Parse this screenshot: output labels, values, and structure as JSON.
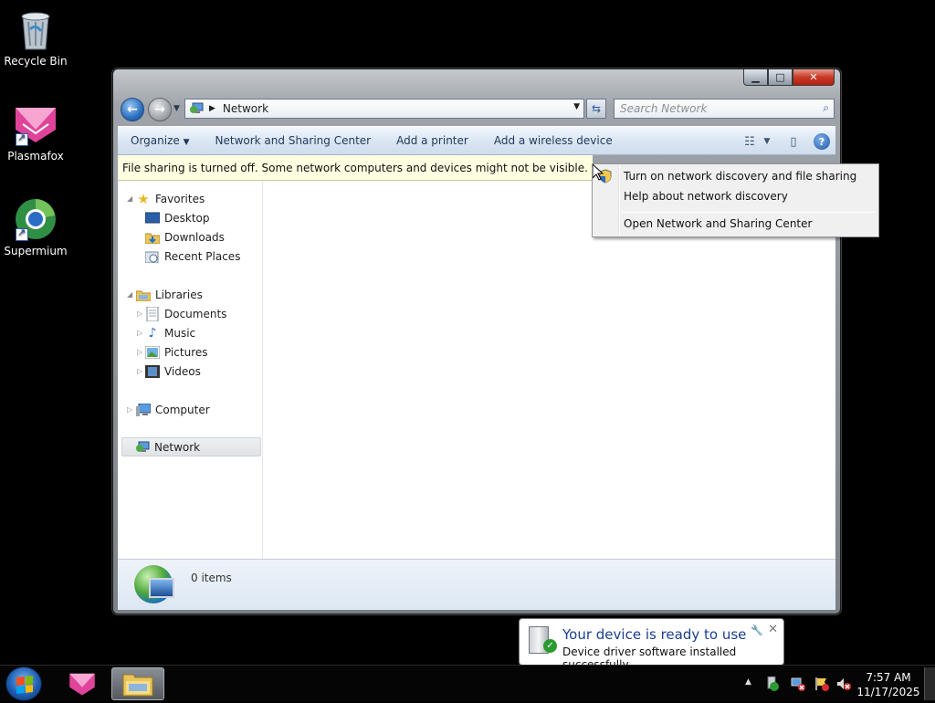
{
  "desktop": {
    "icons": [
      {
        "label": "Recycle Bin",
        "icon": "recycle-bin-icon"
      },
      {
        "label": "Plasmafox",
        "icon": "plasmafox-icon"
      },
      {
        "label": "Supermium",
        "icon": "supermium-icon"
      }
    ]
  },
  "window": {
    "address": {
      "location": "Network"
    },
    "search": {
      "placeholder": "Search Network"
    },
    "toolbar": {
      "organize": "Organize",
      "network_sharing_center": "Network and Sharing Center",
      "add_printer": "Add a printer",
      "add_wireless": "Add a wireless device"
    },
    "infobar": {
      "text": "File sharing is turned off. Some network computers and devices might not be visible. Click to cha"
    },
    "navpane": {
      "favorites": "Favorites",
      "desktop": "Desktop",
      "downloads": "Downloads",
      "recent_places": "Recent Places",
      "libraries": "Libraries",
      "documents": "Documents",
      "music": "Music",
      "pictures": "Pictures",
      "videos": "Videos",
      "computer": "Computer",
      "network": "Network"
    },
    "status": {
      "items": "0 items"
    }
  },
  "context_menu": {
    "items": [
      "Turn on network discovery and file sharing",
      "Help about network discovery",
      "Open Network and Sharing Center"
    ]
  },
  "balloon": {
    "title": "Your device is ready to use",
    "text": "Device driver software installed successfully."
  },
  "taskbar": {
    "clock_time": "7:57 AM",
    "clock_date": "11/17/2025"
  },
  "colors": {
    "accent": "#1e395b",
    "infobar": "#ffffe1",
    "balloon_title": "#1a3f8e"
  }
}
